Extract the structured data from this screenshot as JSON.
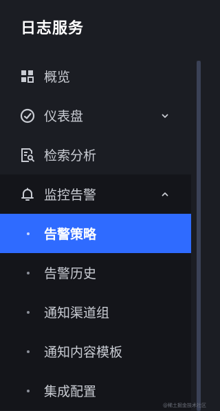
{
  "brand": {
    "title": "日志服务"
  },
  "menu": {
    "overview": {
      "label": "概览",
      "icon": "grid-icon"
    },
    "dashboard": {
      "label": "仪表盘",
      "icon": "gauge-icon",
      "expanded": false
    },
    "search": {
      "label": "检索分析",
      "icon": "doc-search-icon"
    },
    "monitor": {
      "label": "监控告警",
      "icon": "bell-icon",
      "expanded": true,
      "children": [
        {
          "label": "告警策略",
          "active": true
        },
        {
          "label": "告警历史",
          "active": false
        },
        {
          "label": "通知渠道组",
          "active": false
        },
        {
          "label": "通知内容模板",
          "active": false
        },
        {
          "label": "集成配置",
          "active": false
        }
      ]
    }
  },
  "colors": {
    "sidebar_bg": "#1b1d23",
    "submenu_bg": "#14151a",
    "active_bg": "#2f6bff",
    "text": "#c9ccd3",
    "text_active": "#ffffff"
  },
  "watermark": {
    "text": "@稀土掘金技术社区"
  }
}
